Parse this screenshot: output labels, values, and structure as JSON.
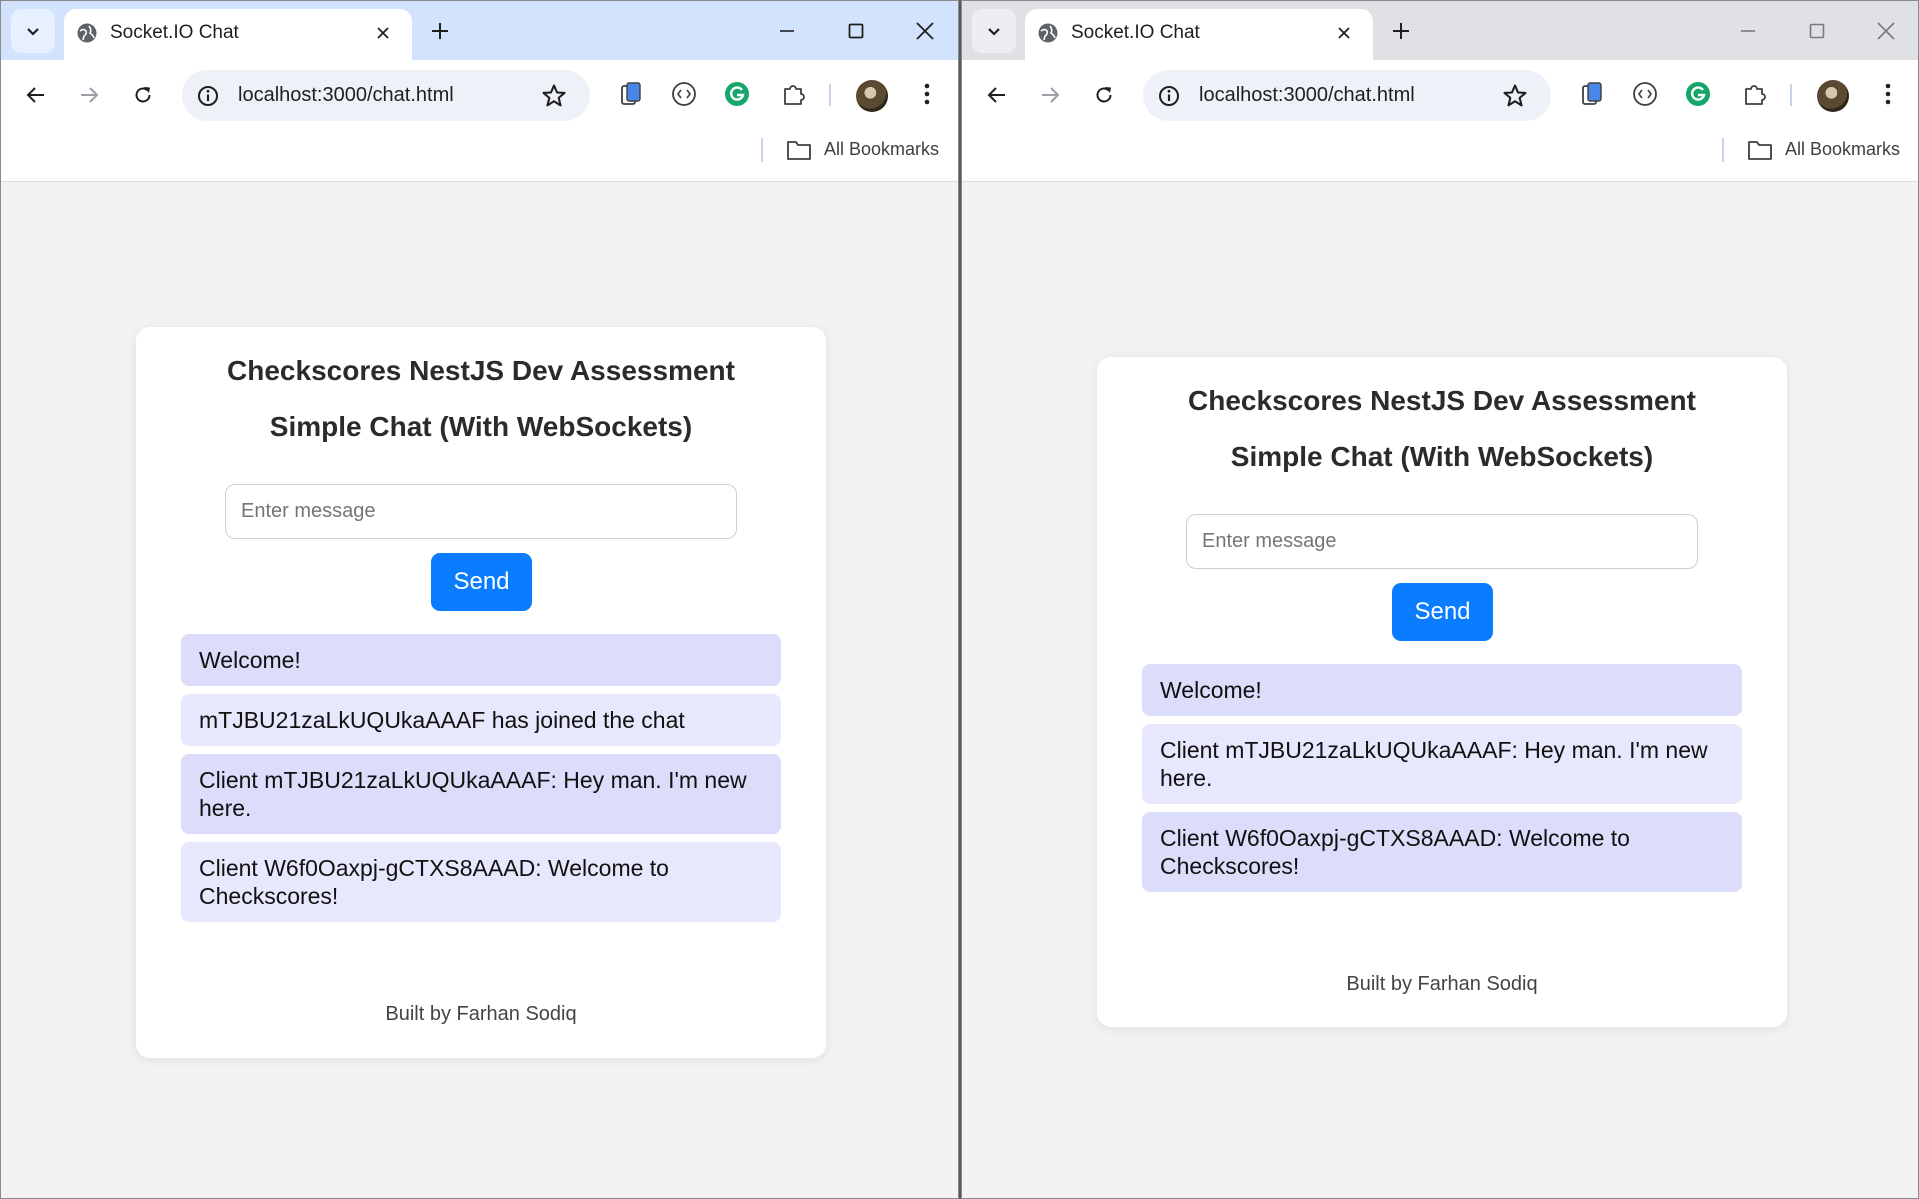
{
  "left": {
    "tab": {
      "title": "Socket.IO Chat"
    },
    "address_bar": {
      "url": "localhost:3000/chat.html"
    },
    "bookmarks": {
      "label": "All Bookmarks"
    },
    "page": {
      "title": "Checkscores NestJS Dev Assessment",
      "subtitle": "Simple Chat (With WebSockets)",
      "input_placeholder": "Enter message",
      "send_label": "Send",
      "messages": [
        "Welcome!",
        "mTJBU21zaLkUQUkaAAAF has joined the chat",
        "Client mTJBU21zaLkUQUkaAAAF: Hey man. I'm new here.",
        "Client W6f0Oaxpj-gCTXS8AAAD: Welcome to Checkscores!"
      ],
      "footer": "Built by Farhan Sodiq"
    }
  },
  "right": {
    "tab": {
      "title": "Socket.IO Chat"
    },
    "address_bar": {
      "url": "localhost:3000/chat.html"
    },
    "bookmarks": {
      "label": "All Bookmarks"
    },
    "page": {
      "title": "Checkscores NestJS Dev Assessment",
      "subtitle": "Simple Chat (With WebSockets)",
      "input_placeholder": "Enter message",
      "send_label": "Send",
      "messages": [
        "Welcome!",
        "Client mTJBU21zaLkUQUkaAAAF: Hey man. I'm new here.",
        "Client W6f0Oaxpj-gCTXS8AAAD: Welcome to Checkscores!"
      ],
      "footer": "Built by Farhan Sodiq"
    }
  },
  "colors": {
    "active_tabstrip": "#d3e3fd",
    "inactive_tabstrip": "#dfe1e5",
    "send_button": "#0a7cff",
    "message_bg": "#dcdcfb"
  },
  "icons": [
    "tab-search-icon",
    "globe-icon",
    "close-icon",
    "plus-icon",
    "minimize-icon",
    "maximize-icon",
    "back-arrow-icon",
    "forward-arrow-icon",
    "reload-icon",
    "info-icon",
    "star-icon",
    "extension-icon",
    "profile-avatar",
    "more-vert-icon",
    "folder-icon"
  ]
}
